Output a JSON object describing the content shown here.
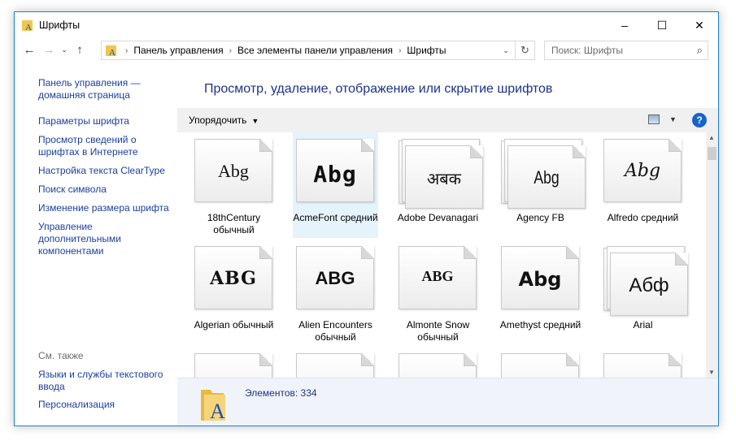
{
  "window": {
    "title": "Шрифты"
  },
  "address": {
    "crumbs": [
      "Панель управления",
      "Все элементы панели управления",
      "Шрифты"
    ]
  },
  "search": {
    "placeholder": "Поиск: Шрифты"
  },
  "left": {
    "links": [
      "Панель управления — домашняя страница",
      "Параметры шрифта",
      "Просмотр сведений о шрифтах в Интернете",
      "Настройка текста ClearType",
      "Поиск символа",
      "Изменение размера шрифта",
      "Управление дополнительными компонентами"
    ],
    "see_also": "См. также",
    "see_also_links": [
      "Языки и службы текстового ввода",
      "Персонализация"
    ]
  },
  "main": {
    "heading": "Просмотр, удаление, отображение или скрытие шрифтов",
    "organize": "Упорядочить",
    "help": "?",
    "fonts": [
      {
        "sample": "Abg",
        "name": "18thCentury обычный",
        "stack": false,
        "selected": false
      },
      {
        "sample": "Abg",
        "name": "AcmeFont средний",
        "stack": false,
        "selected": true
      },
      {
        "sample": "अबक",
        "name": "Adobe Devanagari",
        "stack": true,
        "selected": false
      },
      {
        "sample": "Abg",
        "name": "Agency FB",
        "stack": true,
        "selected": false
      },
      {
        "sample": "Abg",
        "name": "Alfredo средний",
        "stack": false,
        "selected": false
      },
      {
        "sample": "ABG",
        "name": "Algerian обычный",
        "stack": false,
        "selected": false
      },
      {
        "sample": "ABG",
        "name": "Alien Encounters обычный",
        "stack": false,
        "selected": false
      },
      {
        "sample": "ABG",
        "name": "Almonte Snow обычный",
        "stack": false,
        "selected": false
      },
      {
        "sample": "Abg",
        "name": "Amethyst средний",
        "stack": false,
        "selected": false
      },
      {
        "sample": "Абф",
        "name": "Arial",
        "stack": true,
        "selected": false
      },
      {
        "sample": "",
        "name": "",
        "stack": false,
        "selected": false
      },
      {
        "sample": "",
        "name": "",
        "stack": false,
        "selected": false
      },
      {
        "sample": "",
        "name": "",
        "stack": false,
        "selected": false
      },
      {
        "sample": "",
        "name": "",
        "stack": false,
        "selected": false
      },
      {
        "sample": "",
        "name": "",
        "stack": false,
        "selected": false
      }
    ]
  },
  "details": {
    "count": "Элементов: 334"
  },
  "colors": {
    "accent": "#1883d7",
    "link": "#1a3f9e",
    "heading": "#1e3287",
    "selection": "#e5f3fb"
  }
}
